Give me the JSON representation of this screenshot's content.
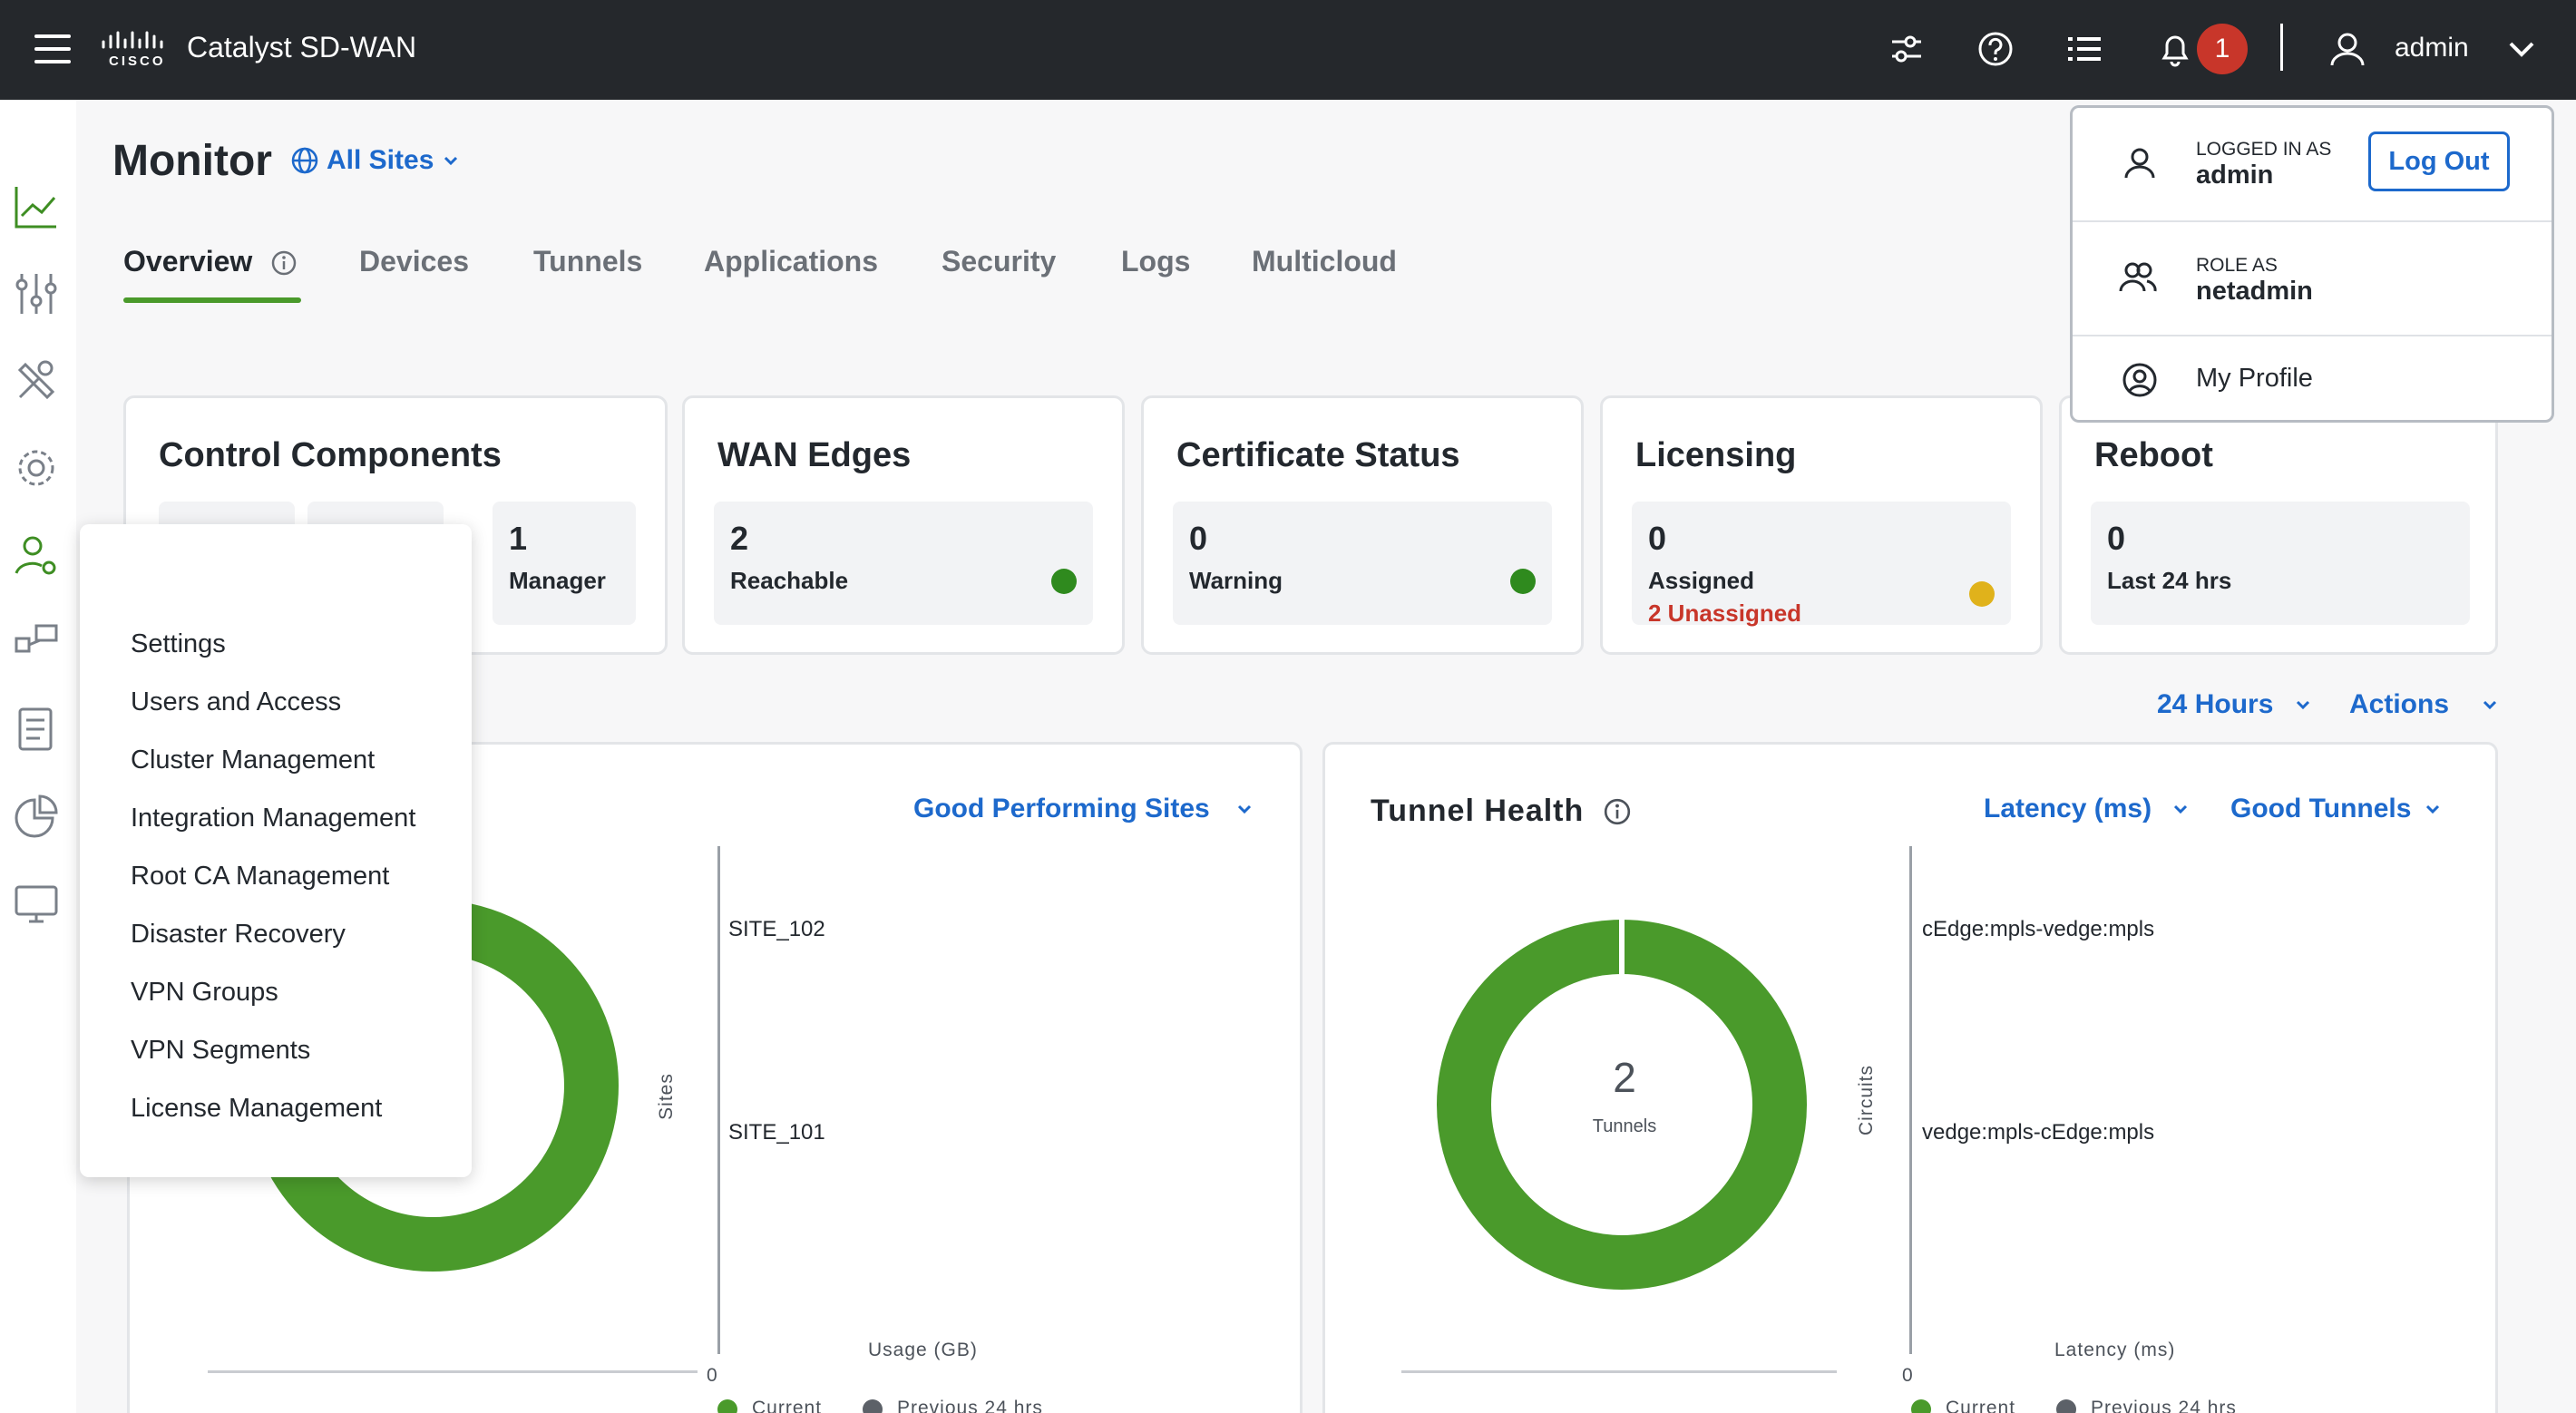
{
  "app": {
    "title": "Catalyst SD-WAN",
    "logo": "cisco"
  },
  "topbar": {
    "notification_count": "1",
    "user": "admin",
    "icons": [
      "hamburger-icon",
      "sliders-icon",
      "help-icon",
      "list-icon",
      "bell-icon",
      "user-icon",
      "chevron-down-icon"
    ]
  },
  "rail": {
    "icons": [
      "monitor-chart-icon",
      "configuration-icon",
      "tools-icon",
      "maintenance-gear-icon",
      "administration-icon",
      "workflows-icon",
      "reports-icon",
      "analytics-icon",
      "explore-icon"
    ]
  },
  "header": {
    "title": "Monitor",
    "site_filter": "All Sites"
  },
  "tabs": [
    "Overview",
    "Devices",
    "Tunnels",
    "Applications",
    "Security",
    "Logs",
    "Multicloud"
  ],
  "cards": {
    "control": {
      "title": "Control Components",
      "tiles": [
        {
          "num": "1",
          "label": "Manager"
        }
      ]
    },
    "wan_edges": {
      "title": "WAN Edges",
      "num": "2",
      "label": "Reachable"
    },
    "certificate": {
      "title": "Certificate Status",
      "num": "0",
      "label": "Warning"
    },
    "licensing": {
      "title": "Licensing",
      "num": "0",
      "label": "Assigned",
      "sub": "2 Unassigned"
    },
    "reboot": {
      "title": "Reboot",
      "num": "0",
      "label": "Last 24 hrs"
    }
  },
  "filters": {
    "time": "24 Hours",
    "actions": "Actions"
  },
  "site_panel": {
    "dropdown": "Good Performing Sites",
    "y_axis": "Sites",
    "x_axis": "Usage (GB)",
    "x_zero": "0",
    "rows": [
      "SITE_102",
      "SITE_101"
    ],
    "legend": [
      "Current",
      "Previous 24 hrs"
    ]
  },
  "tunnel_panel": {
    "title": "Tunnel Health",
    "metric": "Latency (ms)",
    "dropdown": "Good Tunnels",
    "donut_value": "2",
    "donut_label": "Tunnels",
    "y_axis": "Circuits",
    "x_axis": "Latency (ms)",
    "x_zero": "0",
    "rows": [
      "cEdge:mpls-vedge:mpls",
      "vedge:mpls-cEdge:mpls"
    ],
    "legend": [
      "Current",
      "Previous 24 hrs"
    ]
  },
  "admin_menu": {
    "items": [
      "Settings",
      "Users and Access",
      "Cluster Management",
      "Integration Management",
      "Root CA Management",
      "Disaster Recovery",
      "VPN Groups",
      "VPN Segments",
      "License Management"
    ]
  },
  "user_menu": {
    "logged_in_caption": "LOGGED IN AS",
    "logged_in_user": "admin",
    "logout_label": "Log Out",
    "role_caption": "ROLE AS",
    "role": "netadmin",
    "profile_label": "My Profile"
  },
  "colors": {
    "accent_blue": "#1d69cc",
    "good_green": "#4a9a2b",
    "badge_red": "#c8362a",
    "topbar": "#25282c"
  }
}
